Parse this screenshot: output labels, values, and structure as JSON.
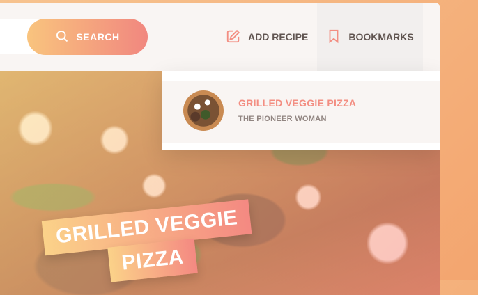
{
  "header": {
    "search": {
      "placeholder": "",
      "button_label": "SEARCH"
    },
    "nav": {
      "add_recipe_label": "ADD RECIPE",
      "bookmarks_label": "BOOKMARKS"
    }
  },
  "bookmarks": [
    {
      "title": "GRILLED VEGGIE PIZZA",
      "publisher": "THE PIONEER WOMAN"
    }
  ],
  "recipe": {
    "title_line1": "GRILLED VEGGIE",
    "title_line2": "PIZZA"
  },
  "colors": {
    "accent_start": "#f9c47e",
    "accent_end": "#f1877f",
    "text_dark": "#615551",
    "text_light": "#918581"
  },
  "icons": [
    "search-icon",
    "edit-icon",
    "bookmark-icon"
  ]
}
